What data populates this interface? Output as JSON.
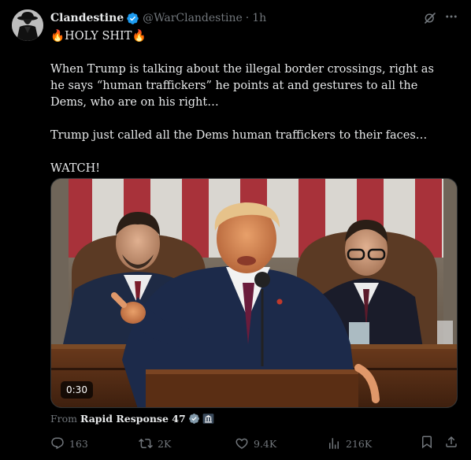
{
  "post": {
    "author_name": "Clandestine",
    "author_handle": "@WarClandestine",
    "separator": "·",
    "time": "1h",
    "paragraphs": [
      "🔥HOLY SHIT🔥",
      "When Trump is talking about the illegal border crossings, right as he says “human traffickers” he points at and gestures to all the Dems, who are on his right…",
      "Trump just called all the Dems human traffickers to their faces…",
      "WATCH!"
    ],
    "video": {
      "duration": "0:30"
    },
    "source": {
      "prefix": "From",
      "name": "Rapid Response 47"
    },
    "stats": {
      "replies": "163",
      "reposts": "2K",
      "likes": "9.4K",
      "views": "216K"
    },
    "icons": {
      "avatar": "avatar-image",
      "verified": "verified-badge-icon",
      "grok": "grok-icon",
      "more": "more-icon",
      "reply": "reply-icon",
      "repost": "repost-icon",
      "like": "like-icon",
      "views": "views-icon",
      "bookmark": "bookmark-icon",
      "share": "share-icon",
      "government": "government-badge-icon"
    },
    "colors": {
      "background": "#000000",
      "text": "#e7e9ea",
      "muted": "#71767b",
      "verified": "#1d9bf0"
    }
  }
}
